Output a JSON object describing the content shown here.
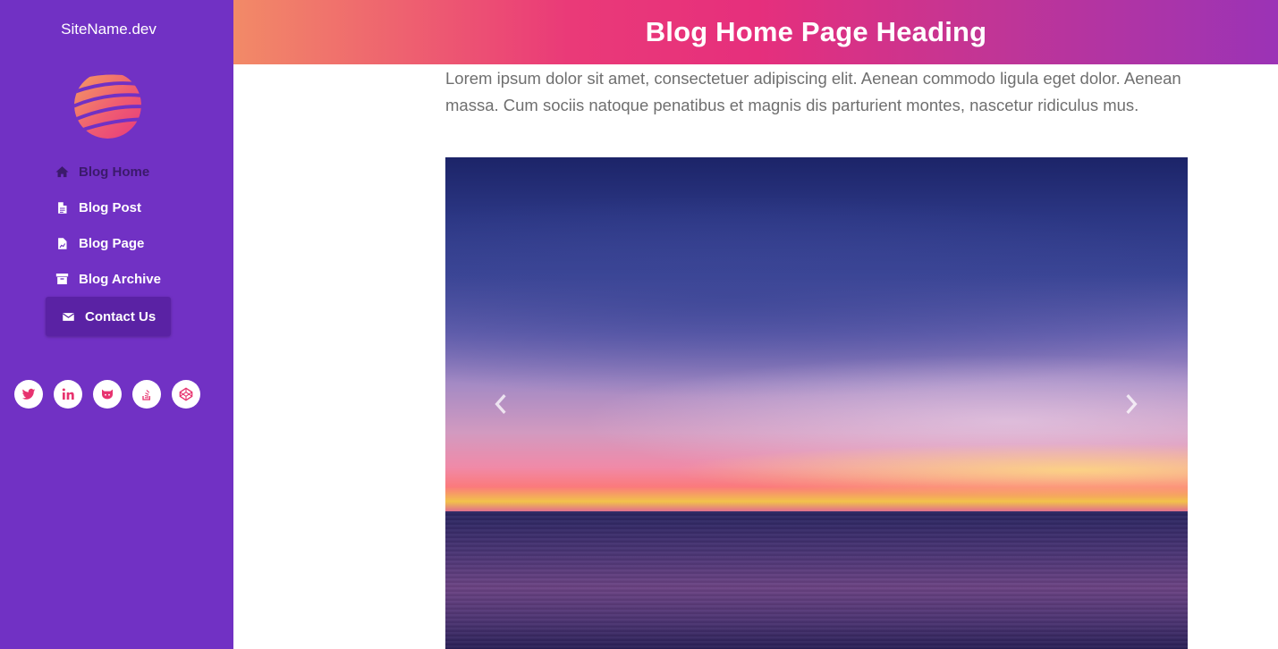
{
  "sidebar": {
    "site_name": "SiteName.dev",
    "nav": [
      {
        "label": "Blog Home",
        "icon": "home-icon"
      },
      {
        "label": "Blog Post",
        "icon": "file-text-icon"
      },
      {
        "label": "Blog Page",
        "icon": "file-chart-icon"
      },
      {
        "label": "Blog Archive",
        "icon": "archive-icon"
      },
      {
        "label": "Contact Us",
        "icon": "envelope-icon"
      }
    ],
    "social": [
      "twitter-icon",
      "linkedin-icon",
      "github-icon",
      "stack-overflow-icon",
      "codepen-icon"
    ]
  },
  "header": {
    "title": "Blog Home Page Heading"
  },
  "main": {
    "intro": "Lorem ipsum dolor sit amet, consectetuer adipiscing elit. Aenean commodo ligula eget dolor. Aenean massa. Cum sociis natoque penatibus et magnis dis parturient montes, nascetur ridiculus mus."
  },
  "colors": {
    "sidebar": "#7131c4",
    "active_nav": "#5a22a4",
    "accent_pink": "#e62f7c",
    "header_gradient_start": "#f28a67",
    "header_gradient_end": "#9b33b6"
  }
}
